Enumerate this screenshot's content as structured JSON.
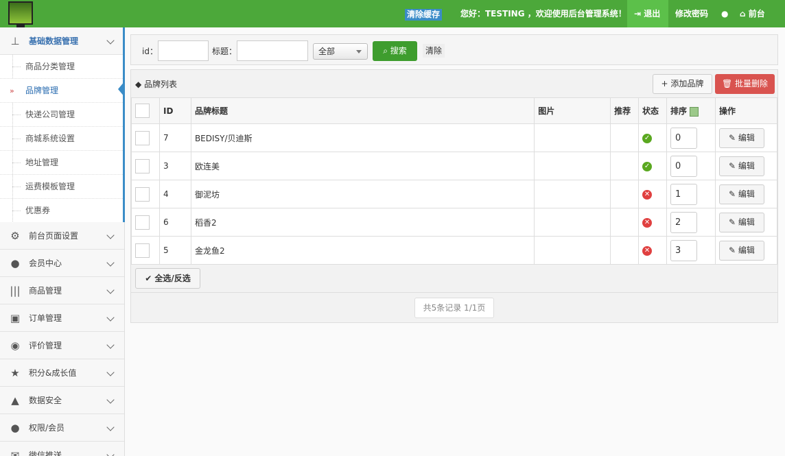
{
  "header": {
    "clear_cache": "清除缓存",
    "welcome": "您好：TESTING ，欢迎使用后台管理系统！",
    "logout": "退出",
    "change_password": "修改密码",
    "front": "前台"
  },
  "sidebar": {
    "active_group": {
      "label": "基础数据管理",
      "icon": "sitemap-icon"
    },
    "sub_items": [
      {
        "label": "商品分类管理"
      },
      {
        "label": "品牌管理"
      },
      {
        "label": "快递公司管理"
      },
      {
        "label": "商城系统设置"
      },
      {
        "label": "地址管理"
      },
      {
        "label": "运费模板管理"
      },
      {
        "label": "优惠券"
      }
    ],
    "groups": [
      {
        "label": "前台页面设置",
        "icon": "gears-icon"
      },
      {
        "label": "会员中心",
        "icon": "user-icon"
      },
      {
        "label": "商品管理",
        "icon": "barcode-icon"
      },
      {
        "label": "订单管理",
        "icon": "cart-icon"
      },
      {
        "label": "评价管理",
        "icon": "comments-icon"
      },
      {
        "label": "积分&成长值",
        "icon": "star-icon"
      },
      {
        "label": "数据安全",
        "icon": "lock-icon"
      },
      {
        "label": "权限/会员",
        "icon": "user-icon"
      },
      {
        "label": "微信推送",
        "icon": "envelope-icon"
      }
    ]
  },
  "search": {
    "id_label": "id：",
    "title_label": "标题：",
    "select_value": "全部",
    "search_button": "搜索",
    "clear_button": "清除"
  },
  "panel": {
    "title": "品牌列表",
    "add_button": "添加品牌",
    "delete_button": "批量删除",
    "columns": [
      "ID",
      "品牌标题",
      "图片",
      "推荐",
      "状态",
      "排序",
      "操作"
    ],
    "rows": [
      {
        "id": "7",
        "title": "BEDISY/贝迪斯",
        "status": "ok",
        "sort": "0",
        "edit": "编辑"
      },
      {
        "id": "3",
        "title": "欧连美",
        "status": "ok",
        "sort": "0",
        "edit": "编辑"
      },
      {
        "id": "4",
        "title": "御泥坊",
        "status": "no",
        "sort": "1",
        "edit": "编辑"
      },
      {
        "id": "6",
        "title": "稻香2",
        "status": "no",
        "sort": "2",
        "edit": "编辑"
      },
      {
        "id": "5",
        "title": "金龙鱼2",
        "status": "no",
        "sort": "3",
        "edit": "编辑"
      }
    ],
    "select_all": "全选/反选",
    "pager": "共5条记录 1/1页"
  }
}
